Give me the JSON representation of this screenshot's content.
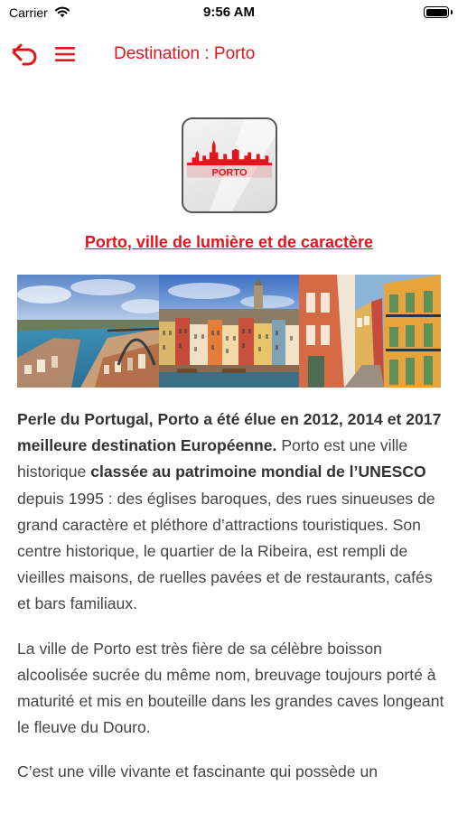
{
  "status": {
    "carrier": "Carrier",
    "time": "9:56 AM"
  },
  "nav": {
    "title": "Destination : Porto",
    "back_icon": "back-arrow-icon",
    "menu_icon": "hamburger-menu-icon"
  },
  "logo": {
    "text": "PORTO"
  },
  "heading": "Porto, ville de lumière et de caractère",
  "paragraph1": {
    "b1": "Perle du Portugal, Porto a été élue en 2012, 2014 et 2017 meilleure destination Européenne.",
    "t1": " Porto est une ville historique ",
    "b2": "classée au patrimoine mondial de l’UNESCO",
    "t2": " depuis 1995 : des églises baroques, des rues sinueuses de grand caractère et pléthore d’attractions touristiques. Son centre historique, le quartier de la Ribeira, est rempli de vieilles maisons, de ruelles pavées et de restaurants, cafés et bars familiaux."
  },
  "paragraph2": "La ville de Porto est très fière de sa célèbre boisson alcoolisée sucrée du même nom, breuvage toujours porté à maturité et mis en bouteille dans les grandes caves longeant le fleuve du Douro.",
  "paragraph3": "C’est une ville vivante et fascinante qui possède un",
  "colors": {
    "accent": "#e2151d",
    "text": "#444444"
  }
}
